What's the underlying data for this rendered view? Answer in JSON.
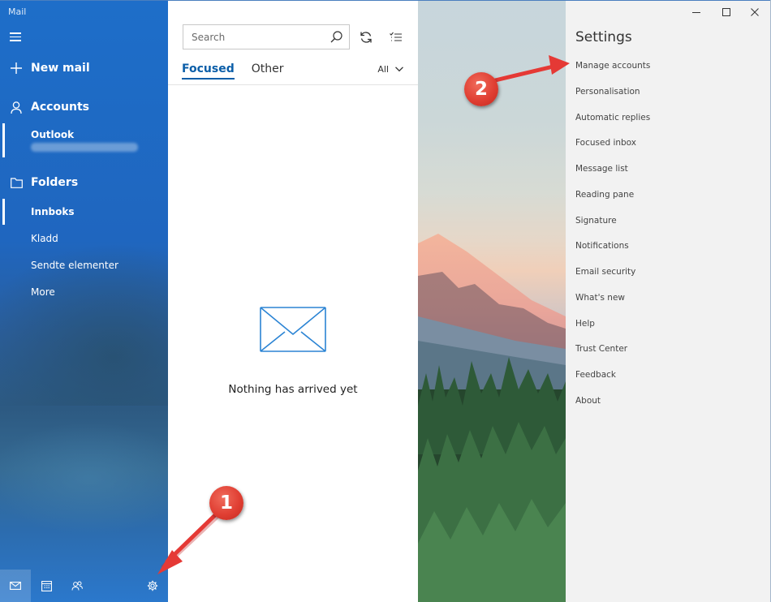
{
  "app": {
    "title": "Mail"
  },
  "sidebar": {
    "new_mail": "New mail",
    "accounts_heading": "Accounts",
    "account_name": "Outlook",
    "folders_heading": "Folders",
    "folders": [
      "Innboks",
      "Kladd",
      "Sendte elementer"
    ],
    "more": "More"
  },
  "search": {
    "placeholder": "Search"
  },
  "tabs": {
    "focused": "Focused",
    "other": "Other",
    "filter": "All"
  },
  "empty_state": {
    "message": "Nothing has arrived yet"
  },
  "settings": {
    "title": "Settings",
    "items": [
      "Manage accounts",
      "Personalisation",
      "Automatic replies",
      "Focused inbox",
      "Message list",
      "Reading pane",
      "Signature",
      "Notifications",
      "Email security",
      "What's new",
      "Help",
      "Trust Center",
      "Feedback",
      "About"
    ]
  },
  "annotations": {
    "step1": "1",
    "step2": "2"
  },
  "colors": {
    "accent": "#0b5ea8",
    "sidebar": "#1f6ac4",
    "callout": "#e03f33",
    "arrow": "#e53935"
  }
}
